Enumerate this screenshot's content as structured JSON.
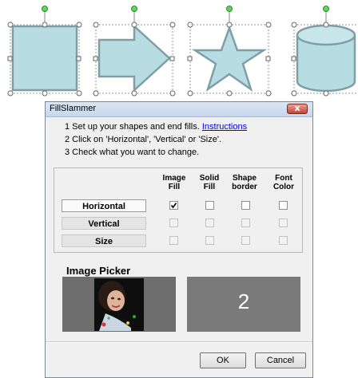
{
  "dialog": {
    "title": "FillSlammer",
    "close_glyph": "x"
  },
  "instructions": {
    "step1": "1 Set up your shapes and end fills.",
    "link": "Instructions",
    "step2": "2 Click on 'Horizontal', 'Vertical' or 'Size'.",
    "step3": "3 Check what you want to change."
  },
  "grid": {
    "columns": [
      {
        "line1": "Image",
        "line2": "Fill"
      },
      {
        "line1": "Solid",
        "line2": "Fill"
      },
      {
        "line1": "Shape",
        "line2": "border"
      },
      {
        "line1": "Font",
        "line2": "Color"
      }
    ],
    "rows": [
      {
        "label": "Horizontal",
        "active": true,
        "checks": [
          true,
          false,
          false,
          false
        ]
      },
      {
        "label": "Vertical",
        "active": false,
        "checks": [
          false,
          false,
          false,
          false
        ]
      },
      {
        "label": "Size",
        "active": false,
        "checks": [
          false,
          false,
          false,
          false
        ]
      }
    ]
  },
  "picker": {
    "label": "Image Picker",
    "preview_number": "2"
  },
  "buttons": {
    "ok": "OK",
    "cancel": "Cancel"
  },
  "colors": {
    "shape_fill": "#b7dde3",
    "shape_stroke": "#7f9ea6",
    "handle_green": "#5fd35f"
  }
}
